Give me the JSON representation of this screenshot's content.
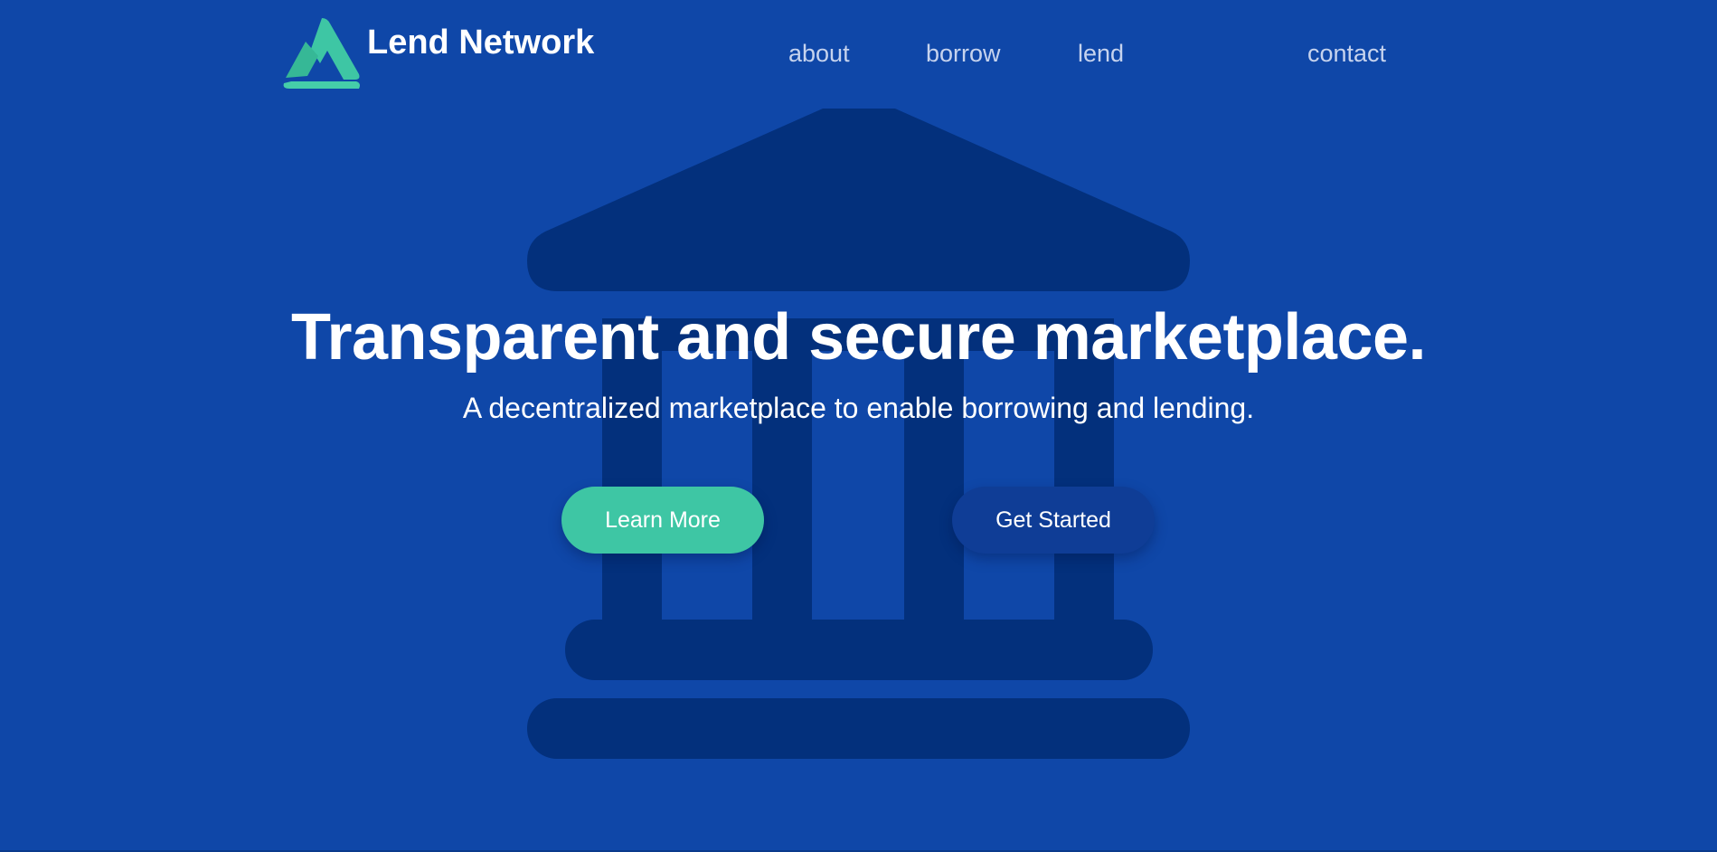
{
  "brand": {
    "name": "Lend Network",
    "logo_icon": "triangle-logo-icon",
    "accent_color": "#3ec6a4"
  },
  "nav": {
    "links": [
      "about",
      "borrow",
      "lend",
      "contact"
    ]
  },
  "hero": {
    "title": "Transparent and secure marketplace.",
    "subtitle": "A decentralized marketplace to enable borrowing and lending.",
    "background_icon": "bank-icon",
    "primary_button": "Learn More",
    "secondary_button": "Get Started"
  },
  "colors": {
    "background": "#0f47a8",
    "bank_illustration": "#03307c",
    "primary_button": "#3ec6a4",
    "secondary_button": "#0f3d96",
    "nav_text": "#c6d3ee"
  }
}
